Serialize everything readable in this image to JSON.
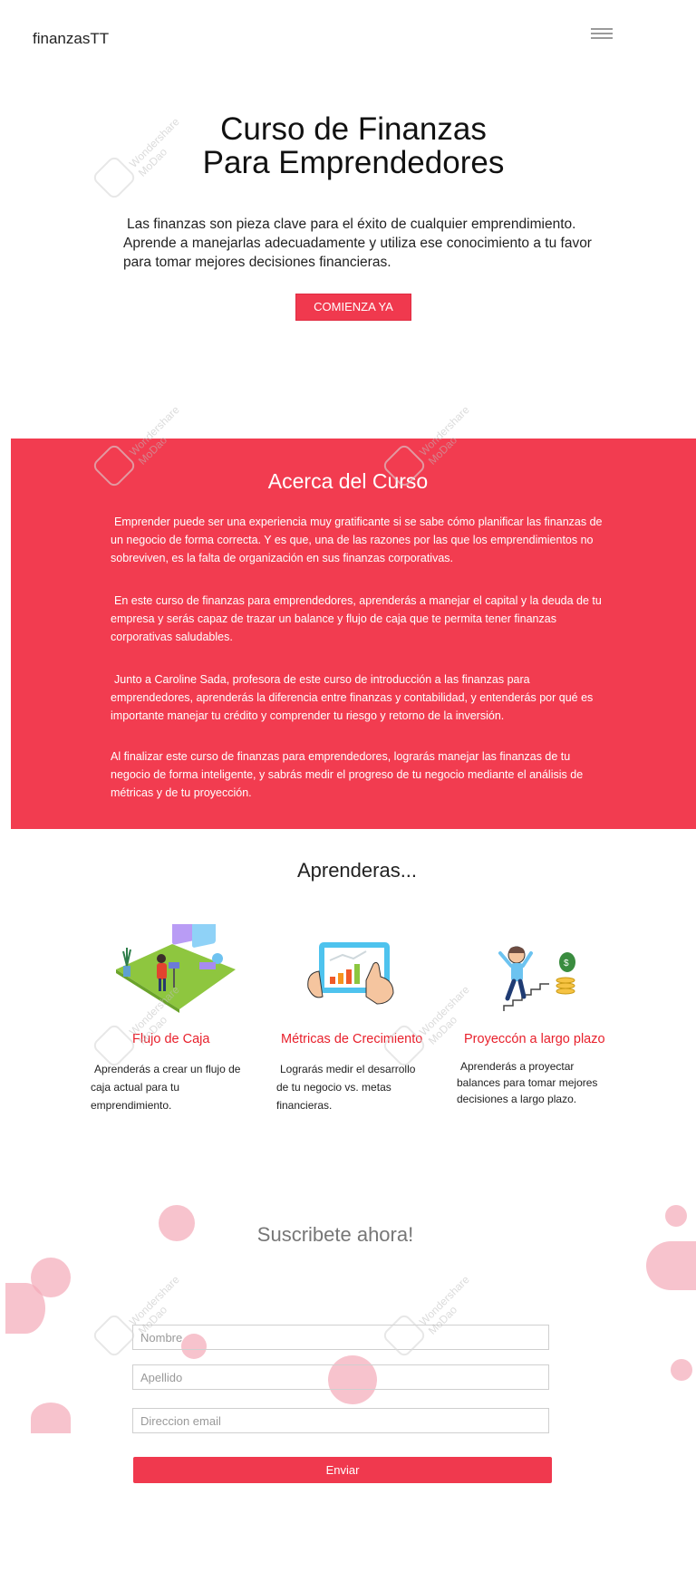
{
  "header": {
    "brand": "finanzasTT"
  },
  "hero": {
    "title_line1": "Curso de Finanzas",
    "title_line2": "Para Emprendedores",
    "description": "Las finanzas son pieza clave para el éxito de cualquier emprendimiento. Aprende a manejarlas adecuadamente y utiliza ese conocimiento a tu favor para tomar mejores decisiones financieras.",
    "cta_label": "COMIENZA YA"
  },
  "about": {
    "title": "Acerca del Curso",
    "paragraphs": [
      "Emprender puede ser una experiencia muy gratificante si se sabe cómo planificar las finanzas de un negocio de forma correcta. Y es que, una de las razones por las que los emprendimientos no sobreviven, es la falta de organización en sus finanzas corporativas.",
      "En este curso de finanzas para emprendedores, aprenderás a manejar el capital y la deuda de tu empresa y serás capaz de trazar un balance y flujo de caja que te permita tener finanzas corporativas saludables.",
      "Junto a Caroline Sada, profesora de este curso de introducción a las finanzas para emprendedores, aprenderás la diferencia entre finanzas y contabilidad, y entenderás por qué es importante manejar tu crédito y comprender tu riesgo y retorno de la inversión.",
      "Al finalizar este curso de finanzas para emprendedores, lograrás manejar las finanzas de tu negocio de forma inteligente, y sabrás medir el progreso de tu negocio mediante el análisis de métricas y de tu proyección."
    ]
  },
  "learn": {
    "title": "Aprenderas...",
    "cards": [
      {
        "title": "Flujo de Caja",
        "description": "Aprenderás a crear un flujo de caja actual para tu emprendimiento.",
        "icon": "cash-flow-illustration"
      },
      {
        "title": "Métricas de Crecimiento",
        "description": "Lograrás medir el desarrollo de tu negocio vs. metas financieras.",
        "icon": "growth-metrics-illustration"
      },
      {
        "title": "Proyeccón a largo plazo",
        "description": "Aprenderás a proyectar balances para tomar mejores decisiones a largo plazo.",
        "icon": "long-term-projection-illustration"
      }
    ]
  },
  "subscribe": {
    "title": "Suscribete ahora!",
    "first_name_placeholder": "Nombre",
    "last_name_placeholder": "Apellido",
    "email_placeholder": "Direccion email",
    "submit_label": "Enviar"
  },
  "watermark": {
    "line1": "Wondershare",
    "line2": "MoDao"
  },
  "colors": {
    "accent": "#f23c50",
    "card_title": "#e8202c",
    "bubble": "#f4a9b8"
  }
}
